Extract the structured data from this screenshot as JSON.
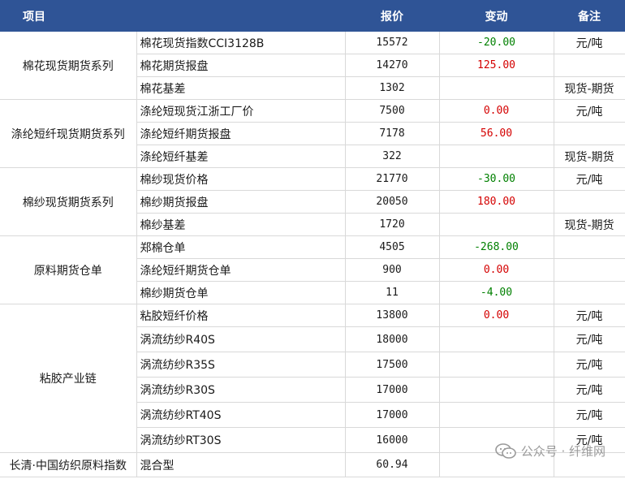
{
  "header": {
    "item": "项目",
    "price": "报价",
    "change": "变动",
    "note": "备注"
  },
  "groups": [
    {
      "name": "棉花现货期货系列",
      "rows": [
        {
          "item": "棉花现货指数CCI3128B",
          "price": "15572",
          "change": "-20.00",
          "note": "元/吨"
        },
        {
          "item": "棉花期货报盘",
          "price": "14270",
          "change": "125.00",
          "note": ""
        },
        {
          "item": "棉花基差",
          "price": "1302",
          "change": "",
          "note": "现货-期货"
        }
      ]
    },
    {
      "name": "涤纶短纤现货期货系列",
      "rows": [
        {
          "item": "涤纶短现货江浙工厂价",
          "price": "7500",
          "change": "0.00",
          "note": "元/吨"
        },
        {
          "item": "涤纶短纤期货报盘",
          "price": "7178",
          "change": "56.00",
          "note": ""
        },
        {
          "item": "涤纶短纤基差",
          "price": "322",
          "change": "",
          "note": "现货-期货"
        }
      ]
    },
    {
      "name": "棉纱现货期货系列",
      "rows": [
        {
          "item": "棉纱现货价格",
          "price": "21770",
          "change": "-30.00",
          "note": "元/吨"
        },
        {
          "item": "棉纱期货报盘",
          "price": "20050",
          "change": "180.00",
          "note": ""
        },
        {
          "item": "棉纱基差",
          "price": "1720",
          "change": "",
          "note": "现货-期货"
        }
      ]
    },
    {
      "name": "原料期货仓单",
      "rows": [
        {
          "item": "郑棉仓单",
          "price": "4505",
          "change": "-268.00",
          "note": ""
        },
        {
          "item": "涤纶短纤期货仓单",
          "price": "900",
          "change": "0.00",
          "note": ""
        },
        {
          "item": "棉纱期货仓单",
          "price": "11",
          "change": "-4.00",
          "note": ""
        }
      ]
    },
    {
      "name": "粘胶产业链",
      "rows": [
        {
          "item": "粘胶短纤价格",
          "price": "13800",
          "change": "0.00",
          "note": "元/吨"
        },
        {
          "item": "涡流纺纱R40S",
          "price": "18000",
          "change": "",
          "note": "元/吨"
        },
        {
          "item": "涡流纺纱R35S",
          "price": "17500",
          "change": "",
          "note": "元/吨"
        },
        {
          "item": "涡流纺纱R30S",
          "price": "17000",
          "change": "",
          "note": "元/吨"
        },
        {
          "item": "涡流纺纱RT40S",
          "price": "17000",
          "change": "",
          "note": "元/吨"
        },
        {
          "item": "涡流纺纱RT30S",
          "price": "16000",
          "change": "",
          "note": "元/吨"
        }
      ]
    }
  ],
  "footer_row": {
    "series": "长清·中国纺织原料指数",
    "item": "混合型",
    "price": "60.94",
    "change": "",
    "note": ""
  },
  "watermark": {
    "icon": "wechat-icon",
    "text": "公众号 · 纤维网"
  },
  "colors": {
    "header_bg": "#2f5496",
    "up": "#d40000",
    "down": "#008000"
  }
}
